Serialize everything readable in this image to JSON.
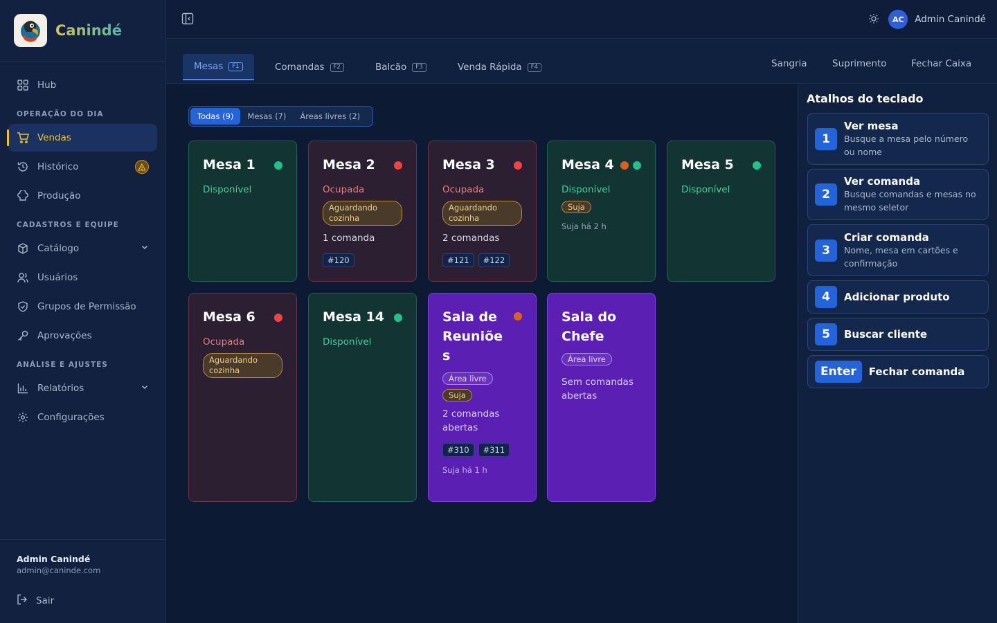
{
  "brand": {
    "name": "Canindé"
  },
  "sidebar": {
    "hub": "Hub",
    "section_day": "OPERAÇÃO DO DIA",
    "vendas": "Vendas",
    "historico": "Histórico",
    "producao": "Produção",
    "section_cad": "CADASTROS E EQUIPE",
    "catalogo": "Catálogo",
    "usuarios": "Usuários",
    "grupos": "Grupos de Permissão",
    "aprovacoes": "Aprovações",
    "section_ana": "ANÁLISE E AJUSTES",
    "relatorios": "Relatórios",
    "config": "Configurações",
    "footer_name": "Admin Canindé",
    "footer_email": "admin@caninde.com",
    "logout": "Sair"
  },
  "topbar": {
    "avatar_initials": "AC",
    "user_name": "Admin Canindé"
  },
  "tabs": [
    {
      "label": "Mesas",
      "key": "F1"
    },
    {
      "label": "Comandas",
      "key": "F2"
    },
    {
      "label": "Balcão",
      "key": "F3"
    },
    {
      "label": "Venda Rápida",
      "key": "F4"
    }
  ],
  "actions": {
    "sangria": "Sangria",
    "suprimento": "Suprimento",
    "fechar": "Fechar Caixa"
  },
  "filters": {
    "all": "Todas (9)",
    "tables": "Mesas (7)",
    "areas": "Áreas livres (2)"
  },
  "colors": {
    "free": "#20c38a",
    "busy": "#ef4444",
    "dirty": "#d9621d",
    "accent": "#2563d9"
  },
  "cards": {
    "m1": {
      "title": "Mesa 1",
      "status": "Disponível"
    },
    "m2": {
      "title": "Mesa 2",
      "status": "Ocupada",
      "pill": "Aguardando cozinha",
      "count": "1 comanda",
      "chips": [
        "#120"
      ]
    },
    "m3": {
      "title": "Mesa 3",
      "status": "Ocupada",
      "pill": "Aguardando cozinha",
      "count": "2 comandas",
      "chips": [
        "#121",
        "#122"
      ]
    },
    "m4": {
      "title": "Mesa 4",
      "status": "Disponível",
      "pill": "Suja",
      "since": "Suja há 2 h"
    },
    "m5": {
      "title": "Mesa 5",
      "status": "Disponível"
    },
    "m6": {
      "title": "Mesa 6",
      "status": "Ocupada",
      "pill": "Aguardando cozinha"
    },
    "m14": {
      "title": "Mesa 14",
      "status": "Disponível"
    },
    "s1": {
      "title": "Sala de Reuniõe s",
      "area": "Área livre",
      "pill": "Suja",
      "count": "2 comandas abertas",
      "chips": [
        "#310",
        "#311"
      ],
      "since": "Suja há 1 h"
    },
    "s2": {
      "title": "Sala do Chefe",
      "area": "Área livre",
      "count": "Sem comandas abertas"
    }
  },
  "shortcuts": {
    "title": "Atalhos do teclado",
    "items": [
      {
        "key": "1",
        "title": "Ver mesa",
        "desc": "Busque a mesa pelo número ou nome"
      },
      {
        "key": "2",
        "title": "Ver comanda",
        "desc": "Busque comandas e mesas no mesmo seletor"
      },
      {
        "key": "3",
        "title": "Criar comanda",
        "desc": "Nome, mesa em cartões e confirmação"
      },
      {
        "key": "4",
        "title": "Adicionar produto",
        "desc": ""
      },
      {
        "key": "5",
        "title": "Buscar cliente",
        "desc": ""
      },
      {
        "key": "Enter",
        "title": "Fechar comanda",
        "desc": ""
      }
    ]
  }
}
